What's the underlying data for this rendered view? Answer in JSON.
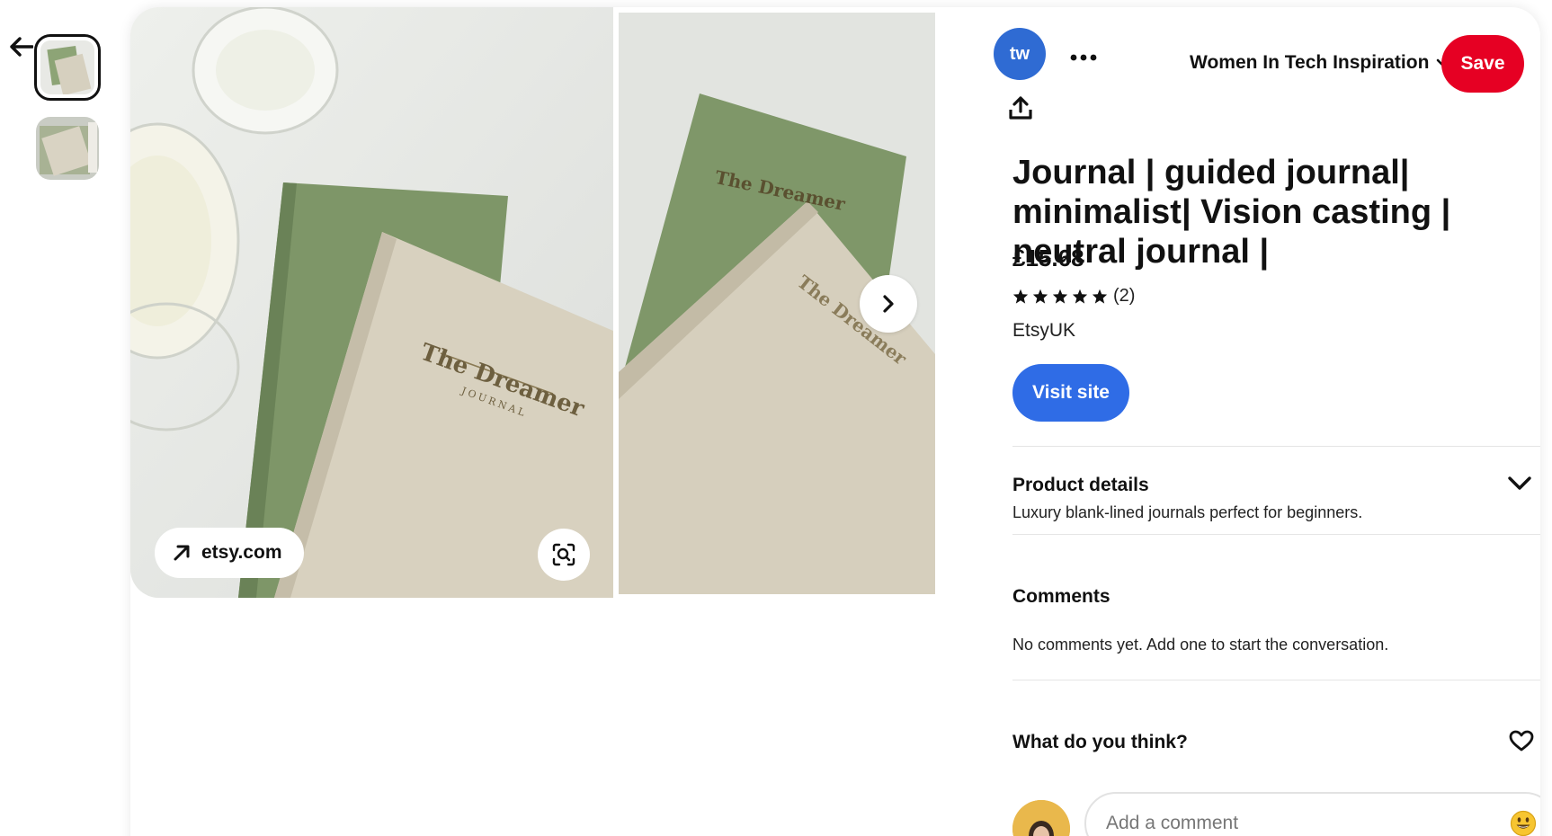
{
  "nav": {
    "back_icon": "arrow-left-icon"
  },
  "thumbnails": [
    {
      "name": "thumbnail-1",
      "active": true
    },
    {
      "name": "thumbnail-2",
      "active": false
    }
  ],
  "pin_images": {
    "main_alt": "The Dreamer journal green and beige",
    "book_title": "The Dreamer",
    "book_subtitle": "JOURNAL",
    "source_domain": "etsy.com",
    "source_icon": "arrow-up-right-icon",
    "lens_icon": "visual-search-icon",
    "next_icon": "chevron-right-icon"
  },
  "header": {
    "profile_initials": "tw",
    "more_icon": "ellipsis-icon",
    "board_name": "Women In Tech Inspiration",
    "board_chevron_icon": "chevron-down-icon",
    "save_label": "Save",
    "share_icon": "share-icon"
  },
  "product": {
    "title": "Journal | guided journal| minimalist| Vision casting | neutral journal |",
    "price": "£15.68",
    "stars": 5,
    "review_count": "(2)",
    "seller": "EtsyUK",
    "visit_label": "Visit site"
  },
  "details": {
    "heading": "Product details",
    "description": "Luxury blank-lined journals perfect for beginners."
  },
  "comments": {
    "heading": "Comments",
    "empty_text": "No comments yet. Add one to start the conversation."
  },
  "feedback": {
    "prompt": "What do you think?",
    "heart_icon": "heart-icon"
  },
  "comment_box": {
    "placeholder": "Add a comment",
    "emoji_icon": "smiley-emoji-icon"
  },
  "colors": {
    "save_red": "#e60023",
    "visit_blue": "#2f6ce6",
    "profile_blue": "#2f6bd3"
  }
}
